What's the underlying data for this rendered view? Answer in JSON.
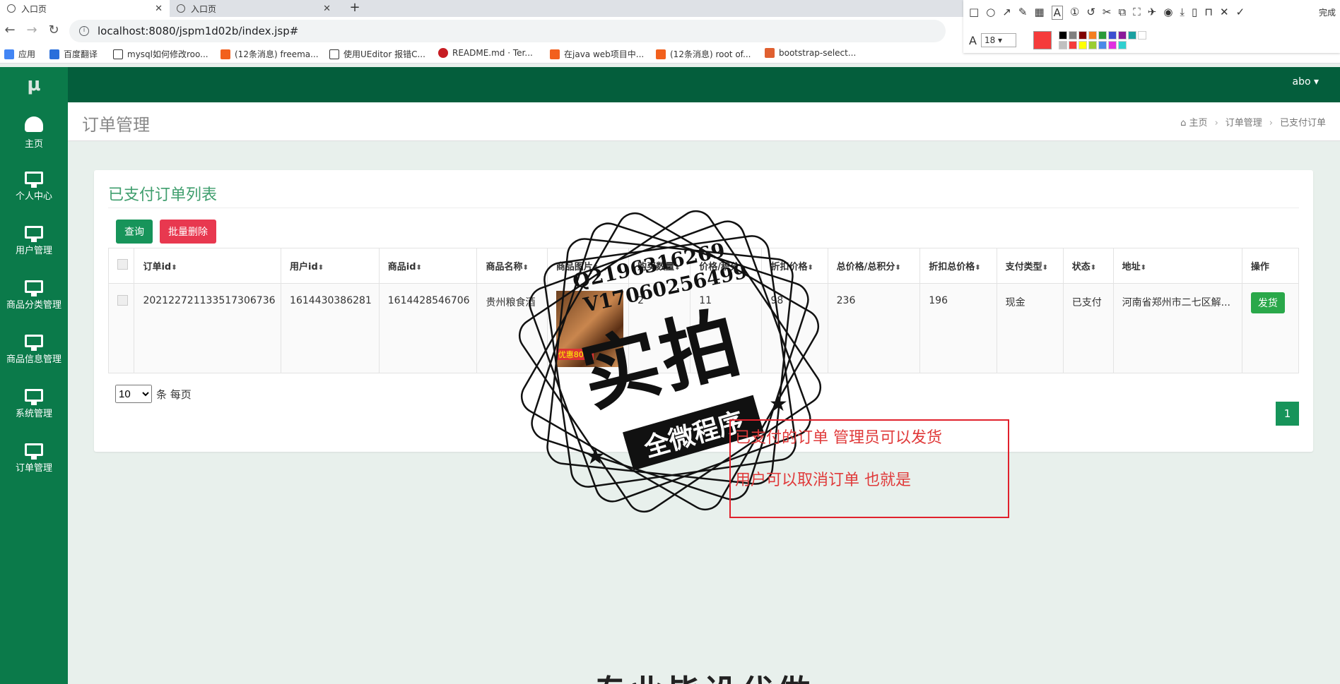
{
  "browser": {
    "tabs": [
      {
        "title": "入口页",
        "active": true
      },
      {
        "title": "入口页",
        "active": false
      }
    ],
    "url": "localhost:8080/jspm1d02b/index.jsp#",
    "bookmarks": [
      {
        "label": "应用",
        "color": "#4285f4"
      },
      {
        "label": "百度翻译",
        "color": "#2a6fdb"
      },
      {
        "label": "mysql如何修改roo...",
        "color": "#333333"
      },
      {
        "label": "(12条消息) freema...",
        "color": "#f2601d"
      },
      {
        "label": "使用UEditor 报错C...",
        "color": "#333333"
      },
      {
        "label": "README.md · Ter...",
        "color": "#c71d23"
      },
      {
        "label": "在java web项目中...",
        "color": "#f2601d"
      },
      {
        "label": "(12条消息) root of...",
        "color": "#f2601d"
      },
      {
        "label": "bootstrap-select...",
        "color": "#e06030"
      }
    ]
  },
  "snip_tool": {
    "done_label": "完成",
    "font_size": "18",
    "palette": [
      "#000000",
      "#808080",
      "#800000",
      "#f47f20",
      "#2a9a3a",
      "#3c4fd0",
      "#8a1a9a",
      "#1aa0a0",
      "#ffffff",
      "#c0c0c0",
      "#f53b3b",
      "#ffff00",
      "#9acd32",
      "#4a8ae8",
      "#e030e0",
      "#30d0d0"
    ]
  },
  "app": {
    "logo": "μ",
    "user": "abo ▾",
    "sidebar": [
      {
        "label": "主页",
        "icon": "dashboard-gauge-icon"
      },
      {
        "label": "个人中心",
        "icon": "monitor-icon"
      },
      {
        "label": "用户管理",
        "icon": "monitor-icon"
      },
      {
        "label": "商品分类管理",
        "icon": "monitor-icon"
      },
      {
        "label": "商品信息管理",
        "icon": "monitor-icon"
      },
      {
        "label": "系统管理",
        "icon": "monitor-icon"
      },
      {
        "label": "订单管理",
        "icon": "monitor-icon"
      }
    ],
    "page_title": "订单管理",
    "breadcrumb": [
      "主页",
      "订单管理",
      "已支付订单"
    ]
  },
  "panel": {
    "title": "已支付订单列表",
    "query_label": "查询",
    "batch_delete_label": "批量删除",
    "columns": [
      "订单id",
      "用户id",
      "商品id",
      "商品名称",
      "商品图片",
      "购买数量",
      "价格/积分",
      "折扣价格",
      "总价格/总积分",
      "折扣总价格",
      "支付类型",
      "状态",
      "地址",
      "操作"
    ],
    "rows": [
      {
        "order_id": "202122721133517306736",
        "user_id": "1614430386281",
        "product_id": "1614428546706",
        "product_name": "贵州粮食酒",
        "image_promo": "优惠80元",
        "quantity": "2",
        "price": "11",
        "discount_price": "98",
        "total": "236",
        "discount_total": "196",
        "pay_type": "现金",
        "status": "已支付",
        "address": "河南省郑州市二七区解...",
        "action": "发货"
      }
    ],
    "page_size": "10",
    "page_size_suffix": "条 每页",
    "current_page": "1"
  },
  "watermark": {
    "qq": "Q2196316269",
    "vx": "V17060256499",
    "big": "实拍",
    "ribbon": "全微程序"
  },
  "annotation": {
    "line1": "已支付的订单  管理员可以发货",
    "line2": "用户可以取消订单  也就是"
  },
  "bottom_text": "专业毕设代做"
}
